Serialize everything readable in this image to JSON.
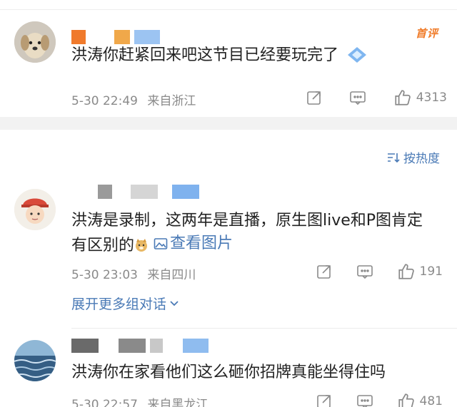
{
  "comments": [
    {
      "text": "洪涛你赶紧回来吧这节目已经要玩完了",
      "date": "5-30 22:49",
      "location": "来自浙江",
      "likes": "4313",
      "badge": "首评"
    },
    {
      "text_part1": "洪涛是录制，这两年是直播，原生图live和P图肯定",
      "text_part2": "有区别的",
      "view_pic": "查看图片",
      "date": "5-30 23:03",
      "location": "来自四川",
      "likes": "191",
      "expand": "展开更多组对话"
    },
    {
      "text": "洪涛你在家看他们这么砸你招牌真能坐得住吗",
      "date": "5-30 22:57",
      "location": "来自黑龙江",
      "likes": "481"
    }
  ],
  "sort": {
    "label": "按热度"
  },
  "colors": {
    "link": "#4a7ab6",
    "meta": "#8a8a8a",
    "badge": "#f07b28",
    "divider": "#f2f2f2"
  },
  "icons": [
    "share-icon",
    "comment-icon",
    "like-icon",
    "sort-icon",
    "image-icon",
    "chevron-down-icon",
    "vip-diamond-icon"
  ]
}
